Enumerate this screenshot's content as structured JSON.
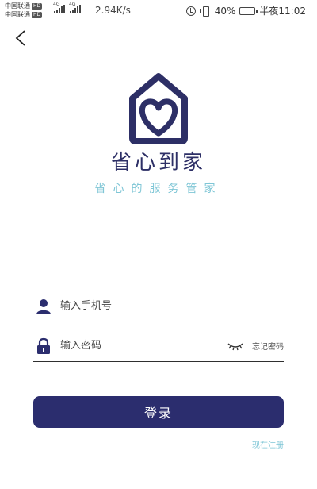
{
  "status_bar": {
    "carrier_1": "中国联通",
    "carrier_2": "中国联通",
    "hd_badge": "HD",
    "signal_tag_1": "4G",
    "signal_tag_2": "4G",
    "network_speed": "2.94K/s",
    "battery": "40%",
    "time": "半夜11:02",
    "battery_level": 0.4
  },
  "header": {
    "back_icon": "chevron-left-icon"
  },
  "brand": {
    "logo_icon": "house-heart-logo",
    "name": "省心到家",
    "slogan": "省心的服务管家",
    "primary_color": "#2b2d6e",
    "accent_color": "#7fc6d6"
  },
  "login_form": {
    "phone_icon": "user-icon",
    "phone_placeholder": "输入手机号",
    "password_icon": "lock-icon",
    "password_placeholder": "输入密码",
    "toggle_icon": "eye-closed-icon",
    "forgot_password": "忘记密码",
    "login_label": "登录",
    "register_link": "现在注册"
  }
}
